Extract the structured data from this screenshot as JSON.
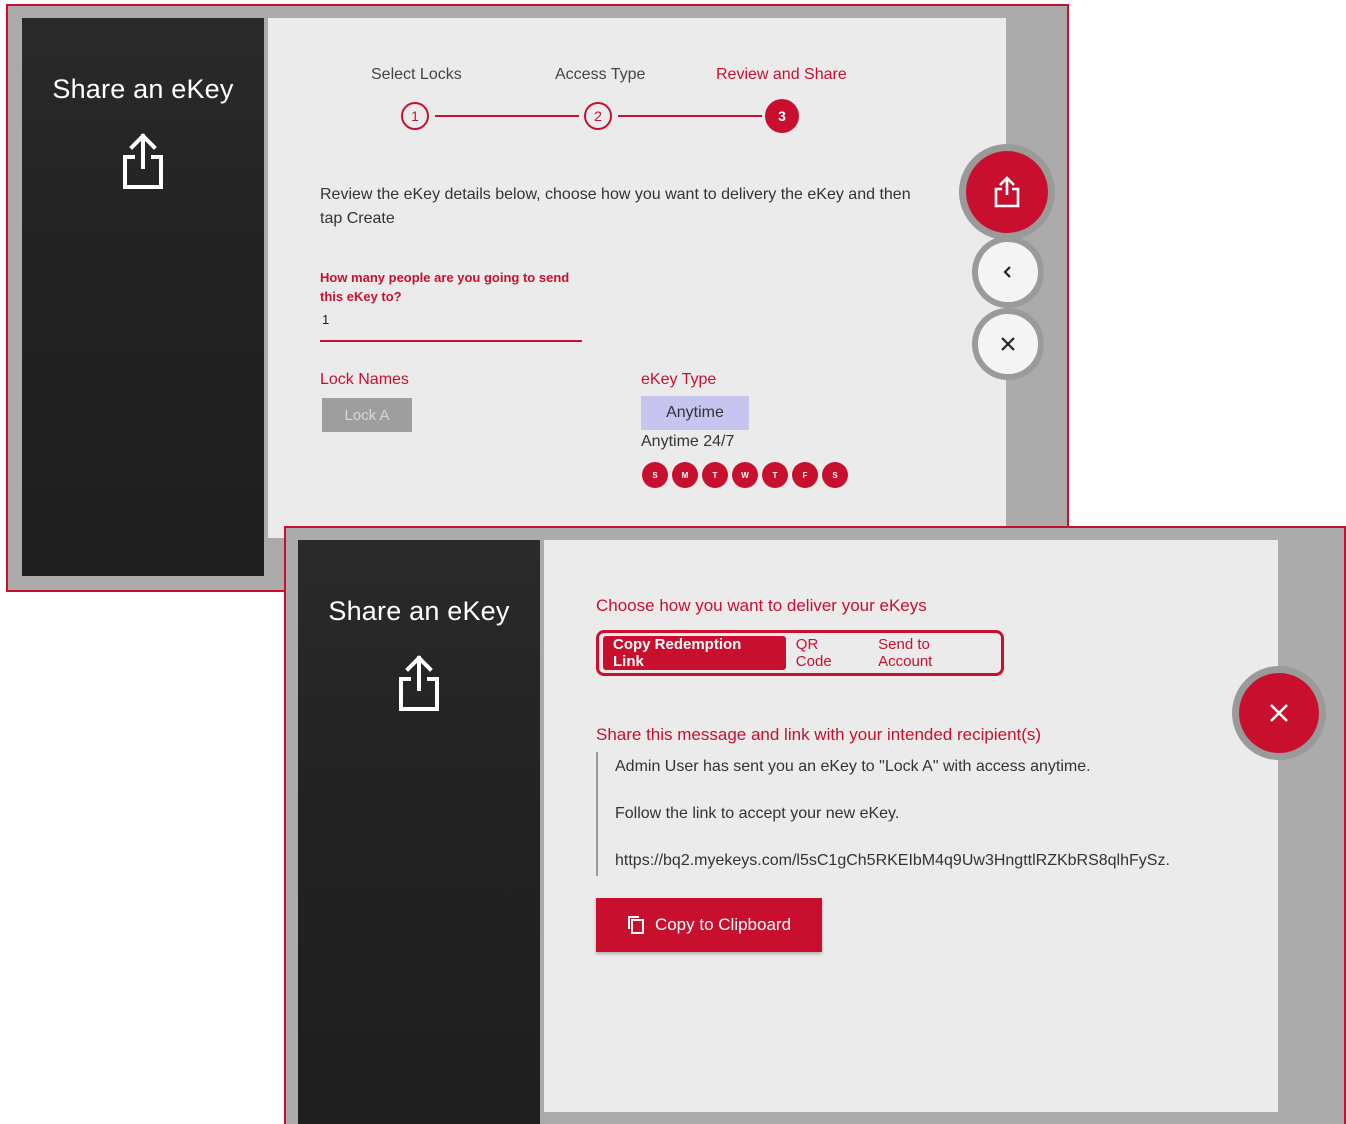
{
  "panel1": {
    "sidebar": {
      "title": "Share an eKey",
      "icon": "share-icon"
    },
    "stepper": {
      "steps": [
        {
          "label": "Select Locks",
          "number": "1"
        },
        {
          "label": "Access Type",
          "number": "2"
        },
        {
          "label": "Review and Share",
          "number": "3"
        }
      ],
      "active_step": 3
    },
    "description": "Review the eKey details below, choose how you want to delivery the eKey and then tap Create",
    "people_field": {
      "label": "How many people are you going to send this eKey to?",
      "value": "1"
    },
    "lock_names": {
      "label": "Lock Names",
      "chip": "Lock A"
    },
    "ekey_type": {
      "label": "eKey Type",
      "chip": "Anytime",
      "subtitle": "Anytime 24/7",
      "days": [
        "S",
        "M",
        "T",
        "W",
        "T",
        "F",
        "S"
      ]
    },
    "fab_buttons": {
      "share": "share-icon",
      "back": "chevron-left-icon",
      "close": "close-icon"
    }
  },
  "panel2": {
    "sidebar": {
      "title": "Share an eKey",
      "icon": "share-icon"
    },
    "delivery_heading": "Choose how you want to deliver your eKeys",
    "tabs": [
      {
        "label": "Copy Redemption Link",
        "active": true
      },
      {
        "label": "QR Code",
        "active": false
      },
      {
        "label": "Send to Account",
        "active": false
      }
    ],
    "message_heading": "Share this message and link with your intended recipient(s)",
    "message": {
      "line1": "Admin User has sent you an eKey to \"Lock A\" with access anytime.",
      "line2": "Follow the link to accept your new eKey.",
      "line3": "https://bq2.myekeys.com/l5sC1gCh5RKEIbM4q9Uw3HngttlRZKbRS8qlhFySz."
    },
    "copy_button": "Copy to Clipboard",
    "fab_close": "close-icon"
  },
  "colors": {
    "accent": "#c8102e",
    "sidebar": "#232323",
    "content_bg": "#ebebeb",
    "frame": "#ababab",
    "type_chip": "#c5c5f0"
  }
}
